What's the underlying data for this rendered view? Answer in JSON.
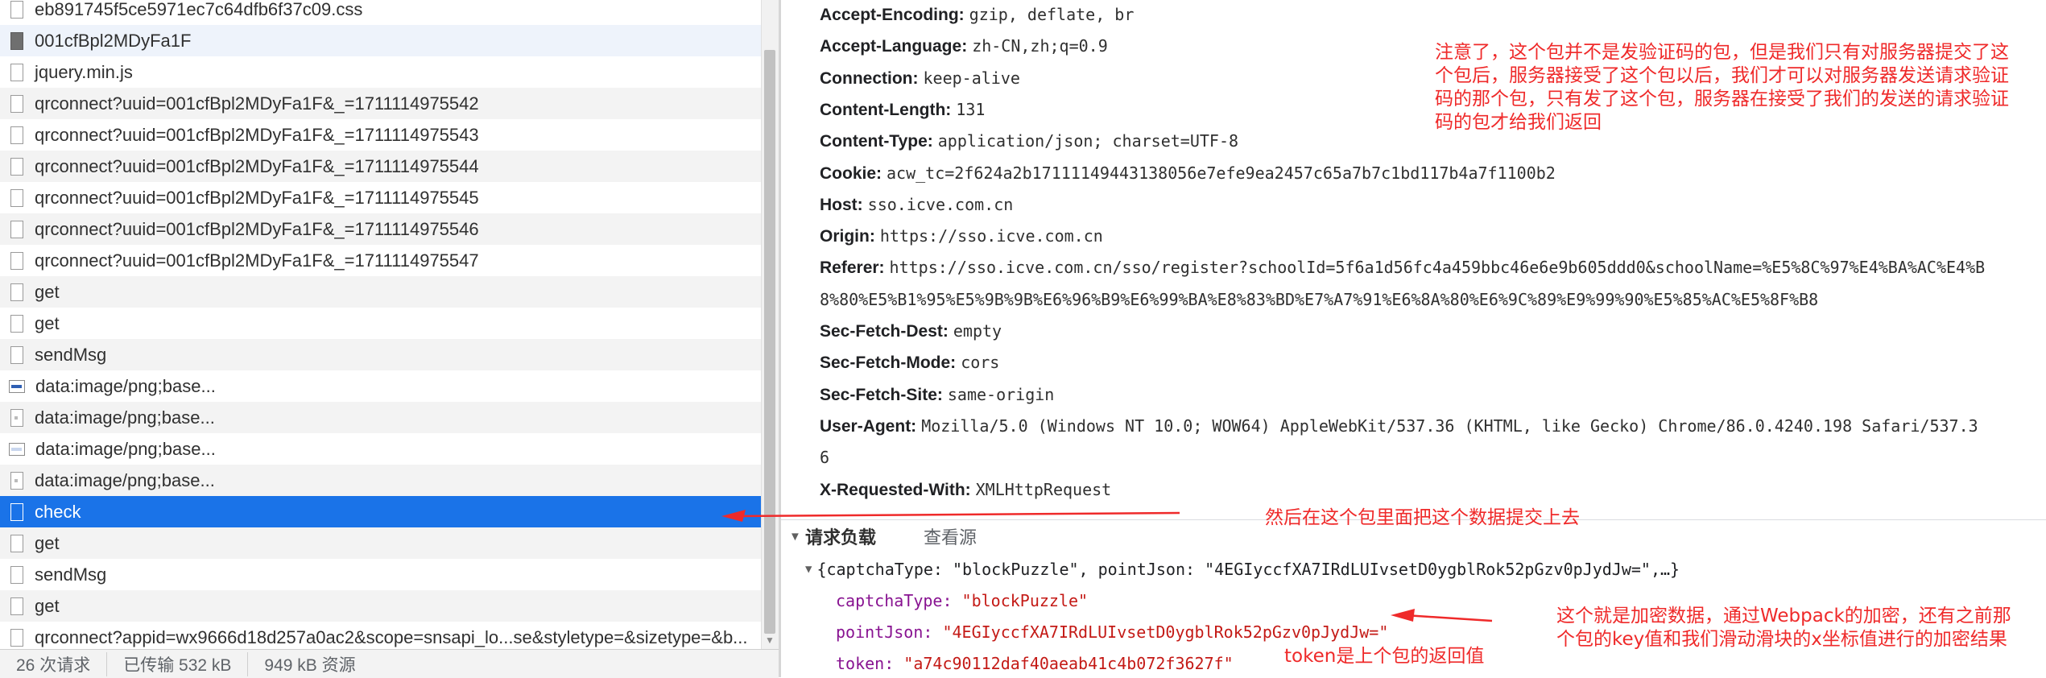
{
  "request_list": [
    {
      "name": "eb891745f5ce5971ec7c64dfb6f37c09.css",
      "icon": "document-icon",
      "alt": false
    },
    {
      "name": "001cfBpl2MDyFa1F",
      "icon": "font-file-icon",
      "alt": true
    },
    {
      "name": "jquery.min.js",
      "icon": "document-icon",
      "alt": false
    },
    {
      "name": "qrconnect?uuid=001cfBpl2MDyFa1F&_=1711114975542",
      "icon": "document-icon",
      "alt": true
    },
    {
      "name": "qrconnect?uuid=001cfBpl2MDyFa1F&_=1711114975543",
      "icon": "document-icon",
      "alt": false
    },
    {
      "name": "qrconnect?uuid=001cfBpl2MDyFa1F&_=1711114975544",
      "icon": "document-icon",
      "alt": true
    },
    {
      "name": "qrconnect?uuid=001cfBpl2MDyFa1F&_=1711114975545",
      "icon": "document-icon",
      "alt": false
    },
    {
      "name": "qrconnect?uuid=001cfBpl2MDyFa1F&_=1711114975546",
      "icon": "document-icon",
      "alt": true
    },
    {
      "name": "qrconnect?uuid=001cfBpl2MDyFa1F&_=1711114975547",
      "icon": "document-icon",
      "alt": false
    },
    {
      "name": "get",
      "icon": "document-icon",
      "alt": true
    },
    {
      "name": "get",
      "icon": "document-icon",
      "alt": false
    },
    {
      "name": "sendMsg",
      "icon": "document-icon",
      "alt": true
    },
    {
      "name": "data:image/png;base...",
      "icon": "image-icon",
      "alt": false
    },
    {
      "name": "data:image/png;base...",
      "icon": "image-dot-icon",
      "alt": true
    },
    {
      "name": "data:image/png;base...",
      "icon": "image-icon-faint",
      "alt": false
    },
    {
      "name": "data:image/png;base...",
      "icon": "image-dot-icon",
      "alt": true
    },
    {
      "name": "check",
      "icon": "document-icon",
      "alt": false,
      "selected": true
    },
    {
      "name": "get",
      "icon": "document-icon",
      "alt": true
    },
    {
      "name": "sendMsg",
      "icon": "document-icon",
      "alt": false
    },
    {
      "name": "get",
      "icon": "document-icon",
      "alt": true
    },
    {
      "name": "qrconnect?appid=wx9666d18d257a0ac2&scope=snsapi_lo...se&styletype=&sizetype=&b...",
      "icon": "document-icon",
      "alt": false
    }
  ],
  "status_bar": {
    "requests": "26 次请求",
    "transferred": "已传输 532 kB",
    "resources": "949 kB 资源"
  },
  "headers": [
    {
      "key": "Accept-Encoding:",
      "value": "gzip, deflate, br"
    },
    {
      "key": "Accept-Language:",
      "value": "zh-CN,zh;q=0.9"
    },
    {
      "key": "Connection:",
      "value": "keep-alive"
    },
    {
      "key": "Content-Length:",
      "value": "131"
    },
    {
      "key": "Content-Type:",
      "value": "application/json; charset=UTF-8"
    },
    {
      "key": "Cookie:",
      "value": "acw_tc=2f624a2b17111149443138056e7efe9ea2457c65a7b7c1bd117b4a7f1100b2"
    },
    {
      "key": "Host:",
      "value": "sso.icve.com.cn"
    },
    {
      "key": "Origin:",
      "value": "https://sso.icve.com.cn"
    },
    {
      "key": "Referer:",
      "value": "https://sso.icve.com.cn/sso/register?schoolId=5f6a1d56fc4a459bbc46e6e9b605ddd0&schoolName=%E5%8C%97%E4%BA%AC%E4%B"
    },
    {
      "key": "",
      "value": "8%80%E5%B1%95%E5%9B%9B%E6%96%B9%E6%99%BA%E8%83%BD%E7%A7%91%E6%8A%80%E6%9C%89%E9%99%90%E5%85%AC%E5%8F%B8"
    },
    {
      "key": "Sec-Fetch-Dest:",
      "value": "empty"
    },
    {
      "key": "Sec-Fetch-Mode:",
      "value": "cors"
    },
    {
      "key": "Sec-Fetch-Site:",
      "value": "same-origin"
    },
    {
      "key": "User-Agent:",
      "value": "Mozilla/5.0 (Windows NT 10.0; WOW64) AppleWebKit/537.36 (KHTML, like Gecko) Chrome/86.0.4240.198 Safari/537.3"
    },
    {
      "key": "",
      "value": "6"
    },
    {
      "key": "X-Requested-With:",
      "value": "XMLHttpRequest"
    }
  ],
  "payload": {
    "toggle_icon": "▼",
    "title": "请求负载",
    "view_source": "查看源",
    "summary": "{captchaType: \"blockPuzzle\", pointJson: \"4EGIyccfXA7IRdLUIvsetD0ygblRok52pGzv0pJydJw=\",…}",
    "fields": [
      {
        "key": "captchaType:",
        "value": "\"blockPuzzle\""
      },
      {
        "key": "pointJson:",
        "value": "\"4EGIyccfXA7IRdLUIvsetD0ygblRok52pGzv0pJydJw=\""
      },
      {
        "key": "token:",
        "value": "\"a74c90112daf40aeab41c4b072f3627f\""
      }
    ]
  },
  "annotations": {
    "note_top": [
      "注意了，这个包并不是发验证码的包，但是我们只有对服务器提交了这",
      "个包后，服务器接受了这个包以后，我们才可以对服务器发送请求验证",
      "码的那个包，只有发了这个包，服务器在接受了我们的发送的请求验证",
      "码的包才给我们返回"
    ],
    "note_check": "然后在这个包里面把这个数据提交上去",
    "note_encrypt": [
      "这个就是加密数据，通过Webpack的加密，还有之前那",
      "个包的key值和我们滑动滑块的x坐标值进行的加密结果"
    ],
    "note_token": "token是上个包的返回值",
    "color": "#ef2a2a"
  },
  "colors": {
    "selected_row": "#1a73e8",
    "json_key": "#881391",
    "json_string": "#c41a16"
  }
}
